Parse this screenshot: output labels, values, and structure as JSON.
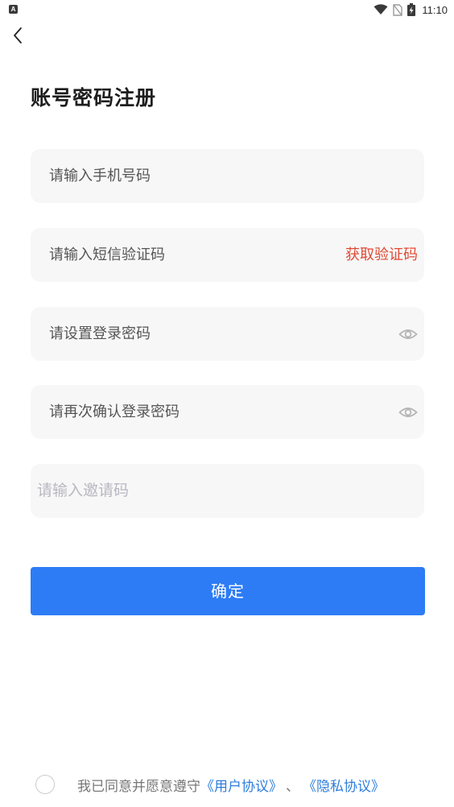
{
  "status_bar": {
    "app_icon_letter": "A",
    "time": "11:10",
    "icons": [
      "wifi-icon",
      "no-sim-icon",
      "battery-charging-icon"
    ]
  },
  "header": {
    "back_icon": "chevron-left-icon",
    "title": "账号密码注册"
  },
  "form": {
    "phone_placeholder": "请输入手机号码",
    "sms_placeholder": "请输入短信验证码",
    "get_code_label": "获取验证码",
    "password_placeholder": "请设置登录密码",
    "confirm_password_placeholder": "请再次确认登录密码",
    "invite_placeholder": "请输入邀请码",
    "eye_icon": "eye-icon"
  },
  "actions": {
    "confirm_label": "确定"
  },
  "agreement": {
    "prefix": "我已同意并愿意遵守",
    "user_agreement": "《用户协议》",
    "separator": "、",
    "privacy_agreement": "《隐私协议》",
    "checked": false
  },
  "colors": {
    "primary": "#2d7cf6",
    "accent_red": "#e04a35",
    "link_blue": "#2e7ddb",
    "field_bg": "#f7f7f7"
  }
}
